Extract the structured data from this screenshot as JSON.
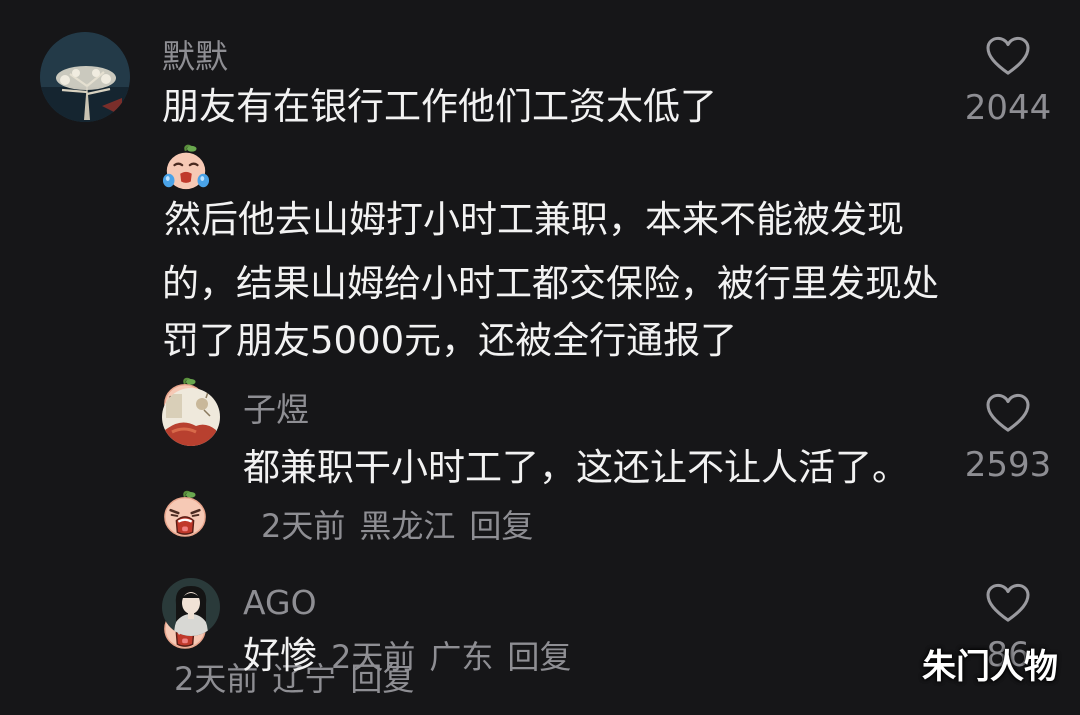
{
  "comments": [
    {
      "username": "默默",
      "text_part1": "朋友有在银行工作他们工资太低了",
      "text_part2": "然后他去山姆打小时工兼职，本来不能被发现的，结果山姆给小时工都交保险，被行里发现处罚了朋友5000元，还被全行通报了",
      "time": "2天前",
      "location": "辽宁",
      "reply_label": "回复",
      "likes": "2044",
      "avatar_icon": "tree-night-avatar",
      "emojis": [
        "crying-face-emoji",
        "wailing-face-emoji",
        "wailing-face-emoji",
        "wailing-face-emoji"
      ]
    },
    {
      "username": "子煜",
      "text": "都兼职干小时工了，这还让不让人活了。",
      "time": "2天前",
      "location": "黑龙江",
      "reply_label": "回复",
      "likes": "2593",
      "avatar_icon": "painting-avatar"
    },
    {
      "username": "AGO",
      "text": "好惨",
      "time": "2天前",
      "location": "广东",
      "reply_label": "回复",
      "likes": "86",
      "avatar_icon": "portrait-avatar"
    }
  ],
  "watermark": "朱门人物",
  "colors": {
    "background": "#161618",
    "text": "#f2f2f2",
    "secondary": "#8e8e93"
  }
}
